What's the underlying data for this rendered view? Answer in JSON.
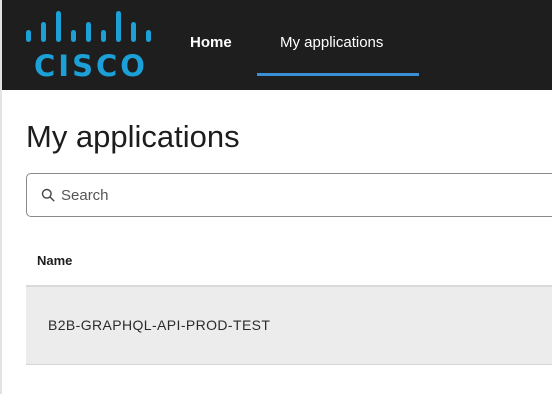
{
  "header": {
    "logo_text": "CISCO",
    "logo_icon": "cisco-bridge-logo",
    "nav": {
      "home_label": "Home",
      "my_applications_label": "My applications",
      "active": "My applications"
    }
  },
  "main": {
    "title": "My applications",
    "search": {
      "placeholder": "Search",
      "value": "",
      "icon": "search-icon"
    },
    "table": {
      "columns": [
        "Name"
      ],
      "rows": [
        {
          "name": "B2B-GRAPHQL-API-PROD-TEST"
        }
      ]
    }
  },
  "colors": {
    "header_bg": "#1e1e1e",
    "logo": "#1ba0d7",
    "active_underline": "#3a8fd6",
    "row_bg": "#ececec"
  }
}
